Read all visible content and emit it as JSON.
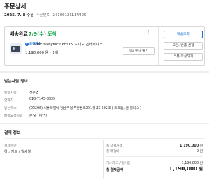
{
  "page": {
    "title": "주문상세",
    "order_date": "2025. 7. 8 주문",
    "order_number_label": "주문번호",
    "order_number": "24100125134426"
  },
  "order": {
    "status": "배송완료",
    "delivery_date": "7/9(수) 도착",
    "product": {
      "badge_mark": "✓",
      "badge": "로켓배송",
      "name": "RME Babyface Pro FS 오디오 인터페이스",
      "price": "1,190,000 원",
      "qty": "1개"
    },
    "cart_button": "장바구니 담기",
    "side_buttons": [
      "배송조회",
      "교환, 반품 신청",
      "리뷰 작성하기"
    ]
  },
  "shipping": {
    "section_title": "받는사람 정보",
    "rows": [
      {
        "label": "받는사람",
        "value": "정수연"
      },
      {
        "label": "연락처",
        "value": "010-7145-8835"
      },
      {
        "label": "받는주소",
        "value": "(06268) 서울특별시 강남구 남부순환로351길 23 202호 ( 도곡동, 원 캘리스 )"
      },
      {
        "label": "배송요청사항",
        "value": "문 앞 (이**)"
      }
    ]
  },
  "payment": {
    "section_title": "결제 정보",
    "method_label": "결제수단",
    "method": "하나카드 / 일시불",
    "summary": [
      {
        "label": "총 상품가격",
        "value": "1,190,000",
        "unit": "원"
      },
      {
        "label": "총 배송비",
        "value": "0",
        "unit": "원"
      }
    ],
    "card_label": "하나카드 / 일시불",
    "card_value": "1,190,000",
    "card_unit": "원",
    "total_label": "총 결제금액",
    "total_value": "1,190,000",
    "total_unit": "원"
  },
  "colors": {
    "accent_green": "#19a24a",
    "accent_blue": "#1c6fd3"
  }
}
